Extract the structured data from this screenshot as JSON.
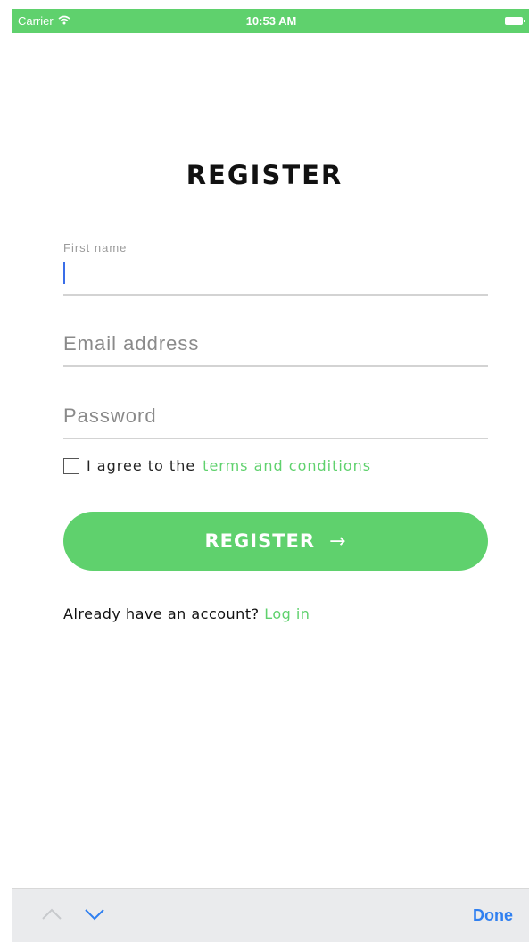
{
  "status_bar": {
    "carrier": "Carrier",
    "time": "10:53 AM",
    "background": "#5fd16d"
  },
  "page": {
    "title": "REGISTER"
  },
  "form": {
    "first_name_label": "First name",
    "first_name_value": "",
    "email_placeholder": "Email address",
    "email_value": "",
    "password_placeholder": "Password",
    "password_value": "",
    "agree_prefix": "I agree to the",
    "terms_link": "terms and conditions",
    "agree_checked": false,
    "register_label": "REGISTER",
    "register_arrow": "→"
  },
  "login": {
    "prompt": "Already have an account?",
    "link": "Log in"
  },
  "keyboard_toolbar": {
    "done_label": "Done",
    "icons": [
      "chevron-up-icon",
      "chevron-down-icon"
    ]
  },
  "colors": {
    "accent": "#5fd16d",
    "done_blue": "#2f7ff0"
  }
}
